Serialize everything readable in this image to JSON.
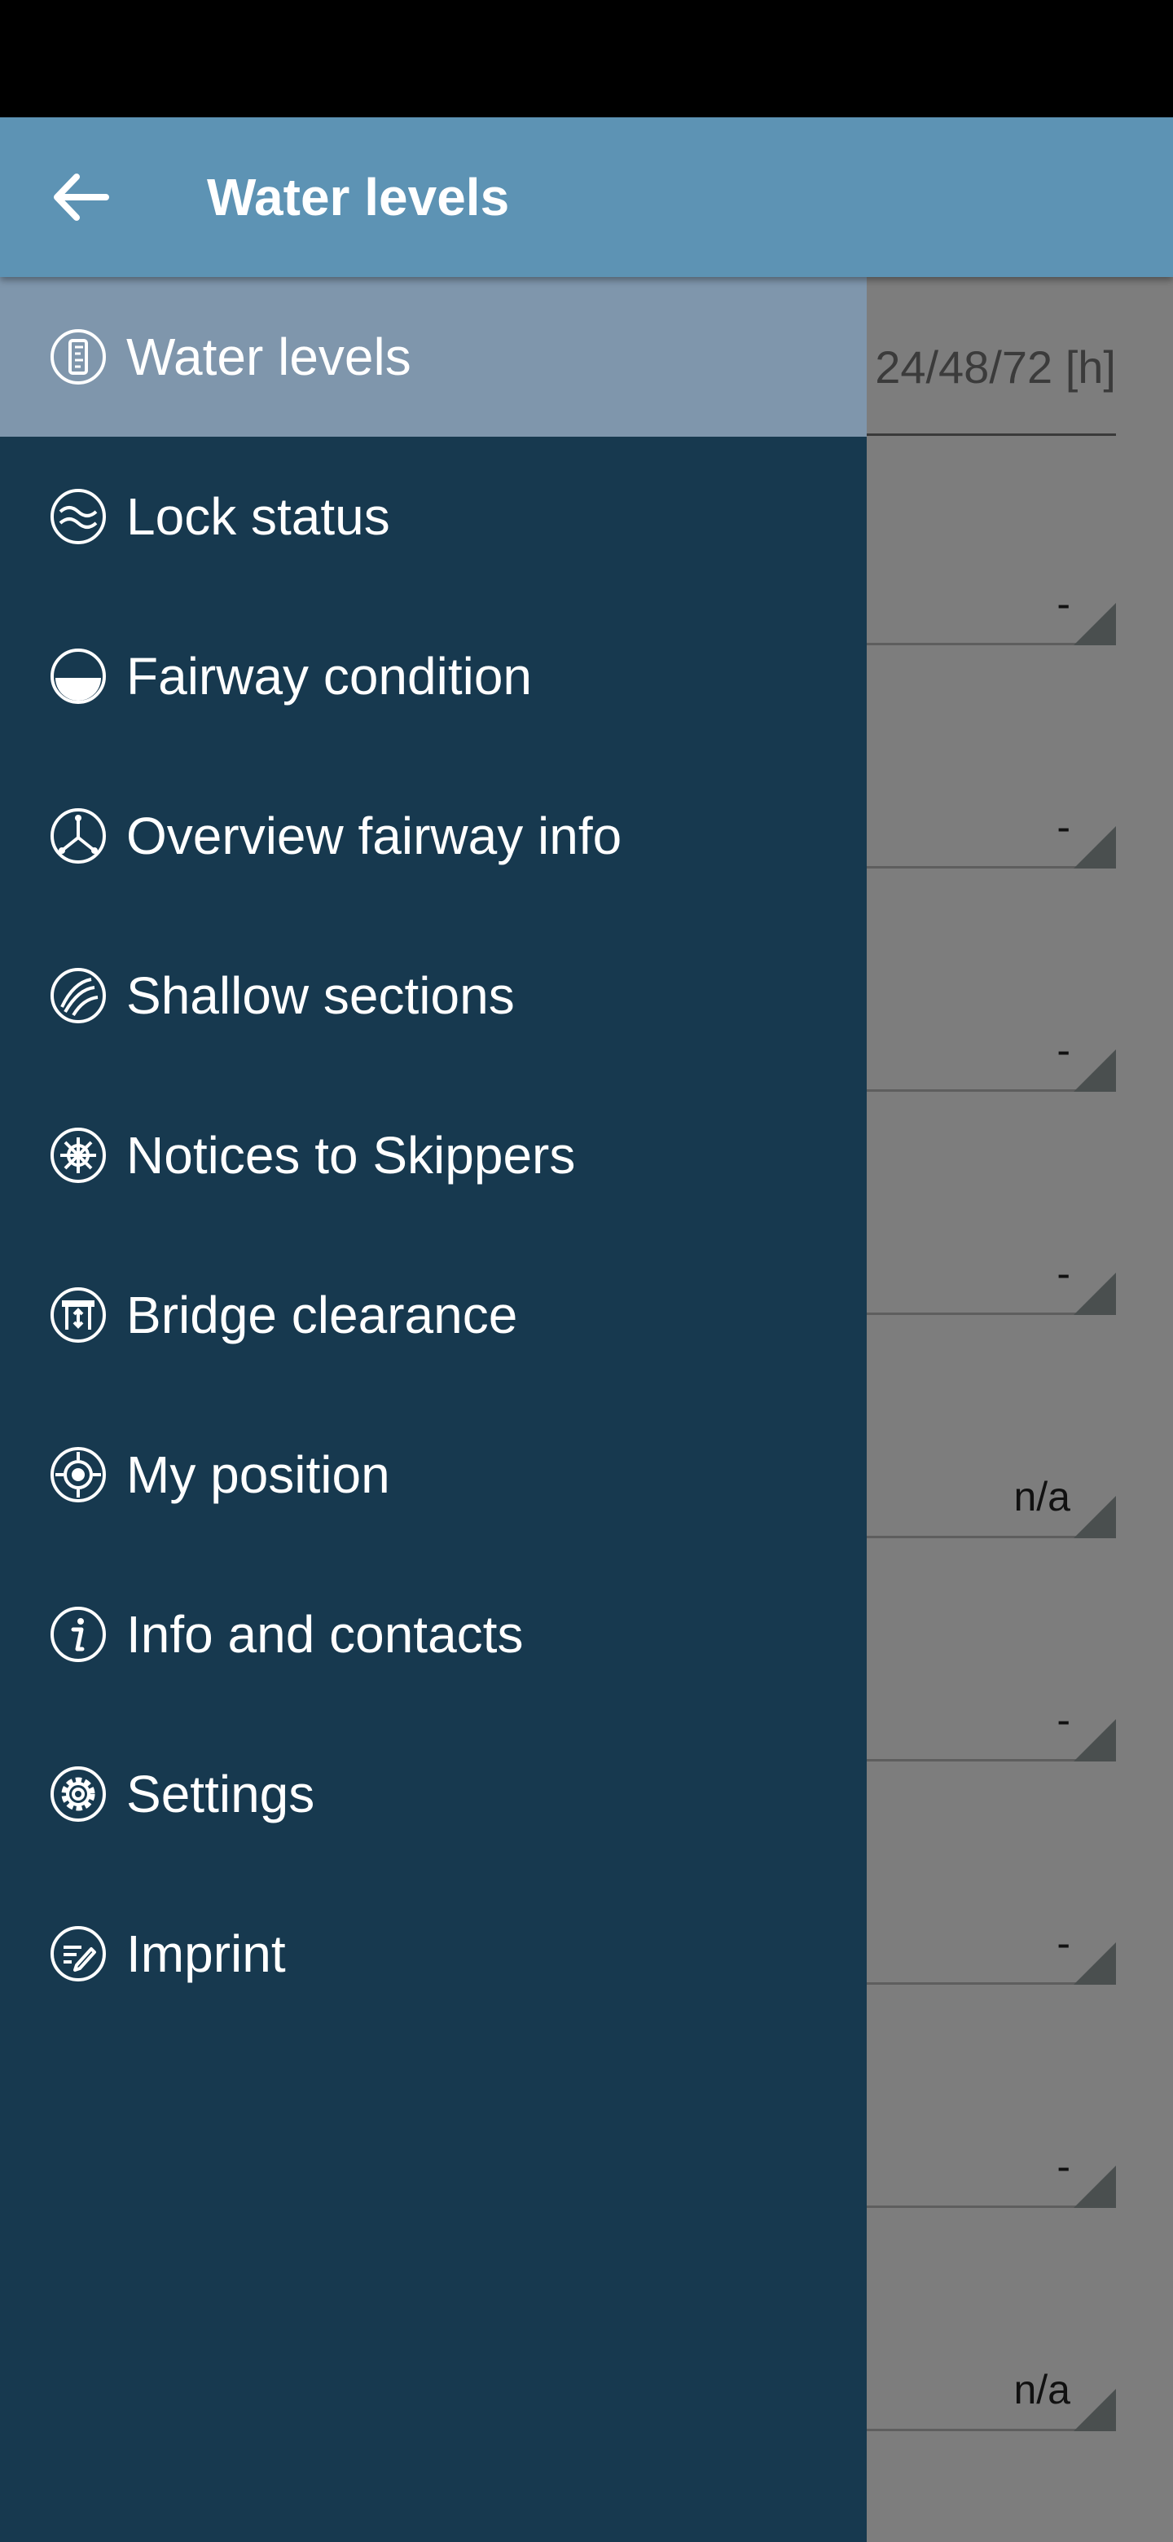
{
  "app_bar": {
    "title": "Water levels",
    "back_icon": "arrow-left-icon"
  },
  "drawer": {
    "items": [
      {
        "label": "Water levels",
        "icon": "gauge-icon",
        "active": true
      },
      {
        "label": "Lock status",
        "icon": "waves-icon",
        "active": false
      },
      {
        "label": "Fairway condition",
        "icon": "half-water-icon",
        "active": false
      },
      {
        "label": "Overview fairway info",
        "icon": "junction-icon",
        "active": false
      },
      {
        "label": "Shallow sections",
        "icon": "sandbank-icon",
        "active": false
      },
      {
        "label": "Notices to Skippers",
        "icon": "ship-wheel-icon",
        "active": false
      },
      {
        "label": "Bridge clearance",
        "icon": "bridge-icon",
        "active": false
      },
      {
        "label": "My position",
        "icon": "crosshair-icon",
        "active": false
      },
      {
        "label": "Info and contacts",
        "icon": "info-icon",
        "active": false
      },
      {
        "label": "Settings",
        "icon": "gear-icon",
        "active": false
      },
      {
        "label": "Imprint",
        "icon": "imprint-icon",
        "active": false
      }
    ]
  },
  "background": {
    "header_text": "24/48/72 [h]",
    "rows": [
      "-",
      "-",
      "-",
      "-",
      "n/a",
      "-",
      "-",
      "-",
      "n/a"
    ]
  },
  "colors": {
    "app_bar": "#5d93b4",
    "drawer": "#17394f",
    "active_item": "#7f96ac",
    "scrim": "#7d7d7d"
  }
}
